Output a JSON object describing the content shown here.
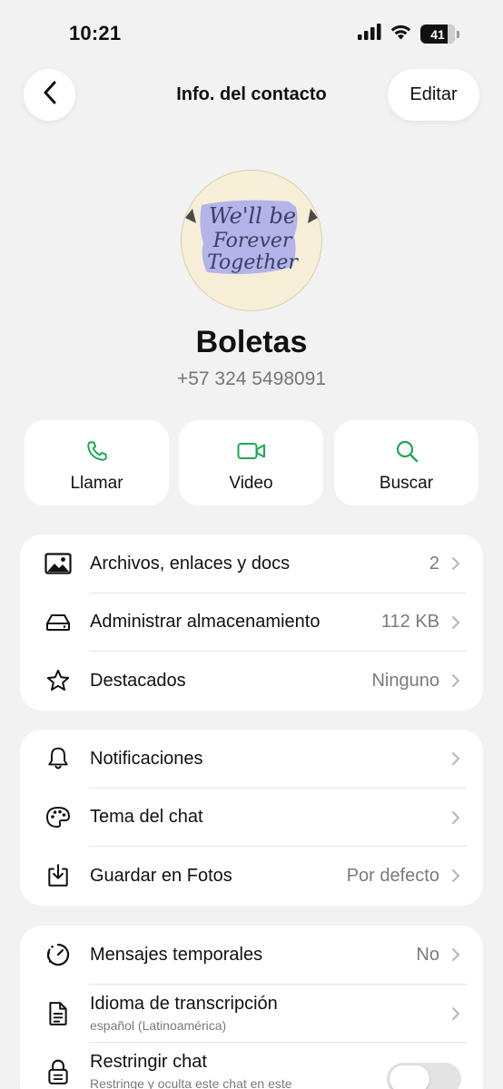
{
  "status_bar": {
    "time": "10:21",
    "battery": "41"
  },
  "nav": {
    "title": "Info. del contacto",
    "edit_label": "Editar"
  },
  "avatar": {
    "line1": "We'll be",
    "line2": "Forever",
    "line3": "Together"
  },
  "contact": {
    "name": "Boletas",
    "phone": "+57 324 5498091"
  },
  "actions": [
    {
      "label": "Llamar",
      "icon": "phone-icon"
    },
    {
      "label": "Video",
      "icon": "video-icon"
    },
    {
      "label": "Buscar",
      "icon": "search-icon"
    }
  ],
  "media_card": [
    {
      "label": "Archivos, enlaces y docs",
      "value": "2",
      "icon": "image-icon"
    },
    {
      "label": "Administrar almacenamiento",
      "value": "112 KB",
      "icon": "storage-icon"
    },
    {
      "label": "Destacados",
      "value": "Ninguno",
      "icon": "star-icon"
    }
  ],
  "settings_card": [
    {
      "label": "Notificaciones",
      "value": "",
      "icon": "bell-icon"
    },
    {
      "label": "Tema del chat",
      "value": "",
      "icon": "palette-icon"
    },
    {
      "label": "Guardar en Fotos",
      "value": "Por defecto",
      "icon": "save-to-photos-icon"
    }
  ],
  "privacy_card": [
    {
      "label": "Mensajes temporales",
      "value": "No",
      "icon": "timer-icon"
    },
    {
      "label": "Idioma de transcripción",
      "subtitle": "español (Latinoamérica)",
      "icon": "document-icon"
    },
    {
      "label": "Restringir chat",
      "subtitle": "Restringe y oculta este chat en este",
      "icon": "lock-icon",
      "toggle_on": false
    }
  ],
  "colors": {
    "accent": "#1da851",
    "background": "#f2f2f2",
    "card": "#ffffff"
  }
}
